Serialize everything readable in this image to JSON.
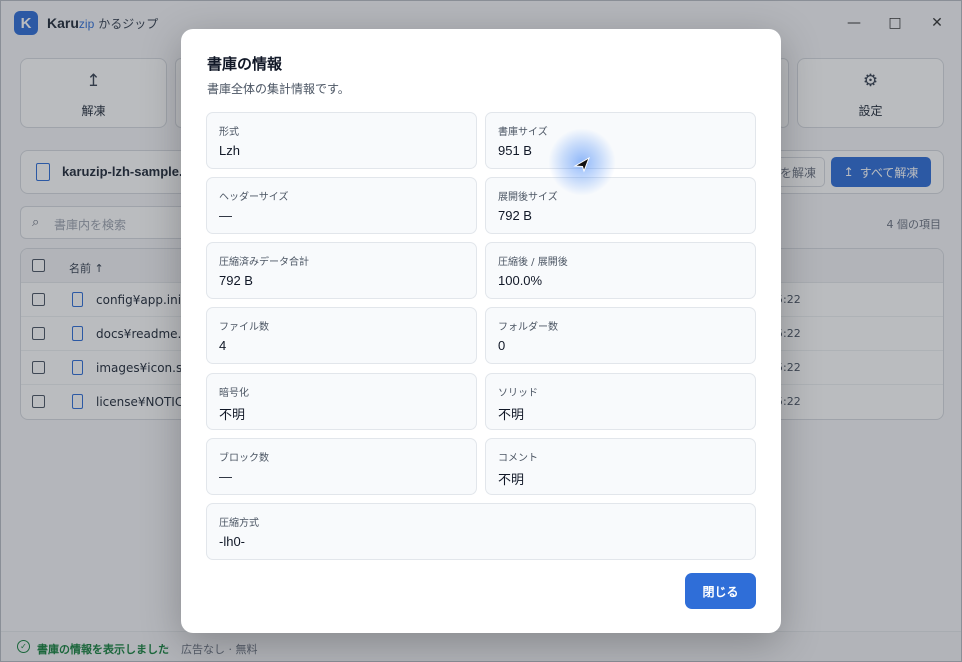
{
  "app": {
    "name_main": "Karu",
    "name_zip": "zip",
    "name_kana": "かるジップ",
    "logo_letter": "K",
    "minimize": "—",
    "maximize": "□",
    "close": "✕"
  },
  "toolbar": {
    "extract_label": "解凍",
    "settings_label": "設定"
  },
  "filebar": {
    "filename": "karuzip-lzh-sample.lzh",
    "extract_selected": "を解凍",
    "extract_all": "すべて解凍"
  },
  "search": {
    "placeholder": "書庫内を検索"
  },
  "item_count": "4 個の項目",
  "table": {
    "header_name": "名前 ↑",
    "rows": [
      {
        "name": "config¥app.ini",
        "time": "5:22"
      },
      {
        "name": "docs¥readme.txt",
        "time": "5:22"
      },
      {
        "name": "images¥icon.svg",
        "time": "5:22"
      },
      {
        "name": "license¥NOTICE",
        "time": "5:22"
      }
    ]
  },
  "status": {
    "message": "書庫の情報を表示しました",
    "separator": "·",
    "ad": "広告なし · 無料"
  },
  "modal": {
    "title": "書庫の情報",
    "description": "書庫全体の集計情報です。",
    "fields": [
      {
        "label": "形式",
        "value": "Lzh"
      },
      {
        "label": "書庫サイズ",
        "value": "951 B"
      },
      {
        "label": "ヘッダーサイズ",
        "value": "—"
      },
      {
        "label": "展開後サイズ",
        "value": "792 B"
      },
      {
        "label": "圧縮済みデータ合計",
        "value": "792 B"
      },
      {
        "label": "圧縮後 / 展開後",
        "value": "100.0%"
      },
      {
        "label": "ファイル数",
        "value": "4"
      },
      {
        "label": "フォルダー数",
        "value": "0"
      },
      {
        "label": "暗号化",
        "value": "不明"
      },
      {
        "label": "ソリッド",
        "value": "不明"
      },
      {
        "label": "ブロック数",
        "value": "—"
      },
      {
        "label": "コメント",
        "value": "不明"
      },
      {
        "label": "圧縮方式",
        "value": "-lh0-"
      }
    ],
    "close_label": "閉じる"
  },
  "colors": {
    "accent": "#2f6ed8",
    "success": "#15803d"
  },
  "icons": {
    "upload": "↥",
    "gear": "⚙",
    "search": "⌕",
    "check": "✓"
  }
}
